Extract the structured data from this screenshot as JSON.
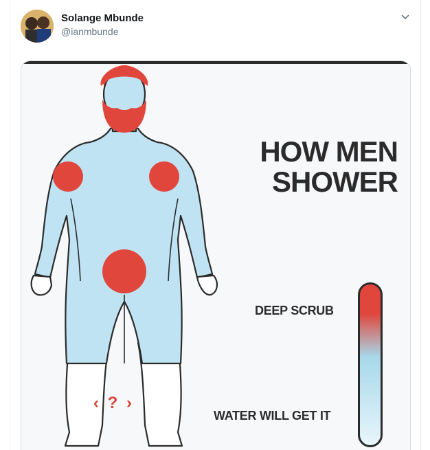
{
  "tweet": {
    "display_name": "Solange Mbunde",
    "handle": "@ianmbunde"
  },
  "image": {
    "title_line1": "HOW MEN",
    "title_line2": "SHOWER",
    "scale_top_label": "DEEP SCRUB",
    "scale_bottom_label": "WATER WILL GET IT",
    "question_marker": "‹ ? ›"
  },
  "colors": {
    "scrub_red": "#e0463b",
    "water_blue": "#a8d8ea",
    "outline": "#2b2b2b"
  }
}
